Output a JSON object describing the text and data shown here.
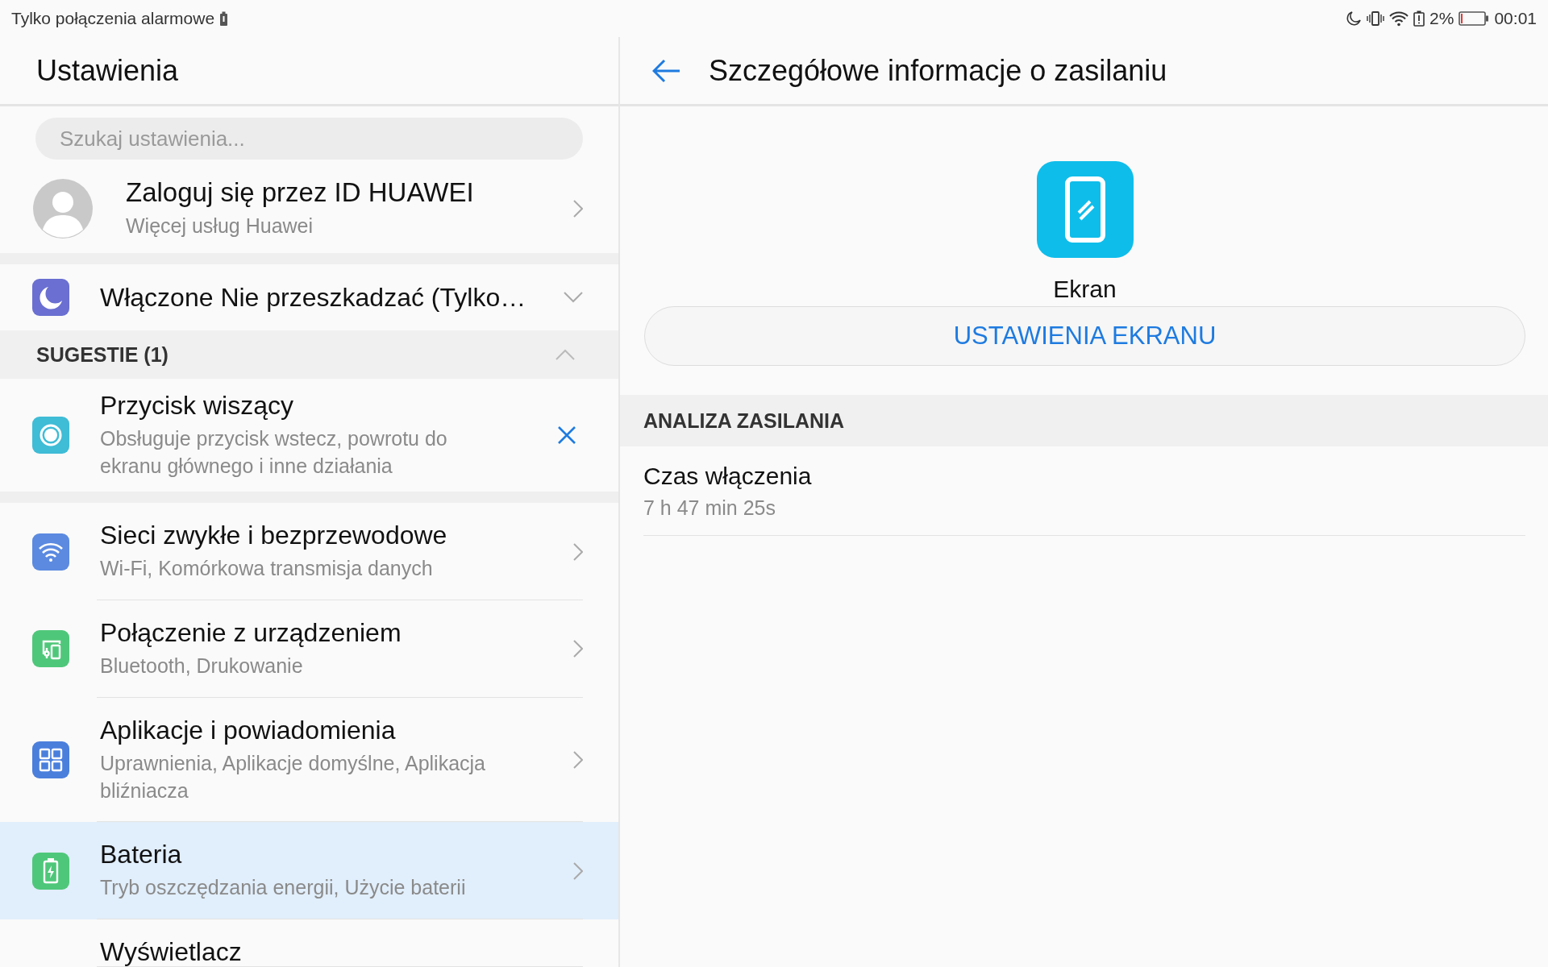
{
  "status_bar": {
    "left_text": "Tylko połączenia alarmowe",
    "battery_percent": "2%",
    "time": "00:01"
  },
  "settings": {
    "title": "Ustawienia",
    "search": {
      "placeholder": "Szukaj ustawienia..."
    },
    "account": {
      "title": "Zaloguj się przez ID HUAWEI",
      "subtitle": "Więcej usług Huawei"
    },
    "dnd": {
      "label": "Włączone Nie przeszkadzać (Tylko…",
      "expanded": false
    },
    "suggestions": {
      "label": "SUGESTIE (1)",
      "expanded": true,
      "items": [
        {
          "title": "Przycisk wiszący",
          "subtitle": "Obsługuje przycisk wstecz, powrotu do ekranu głównego i inne działania"
        }
      ]
    },
    "categories": [
      {
        "kind": "wifi",
        "color": "#5b8ae0",
        "title": "Sieci zwykłe i bezprzewodowe",
        "subtitle": "Wi-Fi, Komórkowa transmisja danych",
        "selected": false
      },
      {
        "kind": "devices",
        "color": "#4fc77a",
        "title": "Połączenie z urządzeniem",
        "subtitle": "Bluetooth, Drukowanie",
        "selected": false
      },
      {
        "kind": "apps",
        "color": "#4a7fdc",
        "title": "Aplikacje i powiadomienia",
        "subtitle": "Uprawnienia, Aplikacje domyślne, Aplikacja bliźniacza",
        "selected": false
      },
      {
        "kind": "battery",
        "color": "#4fc77a",
        "title": "Bateria",
        "subtitle": "Tryb oszczędzania energii, Użycie baterii",
        "selected": true
      },
      {
        "title": "Wyświetlacz",
        "selected": false
      }
    ]
  },
  "detail": {
    "title": "Szczegółowe informacje o zasilaniu",
    "app_name": "Ekran",
    "button": "USTAWIENIA EKRANU",
    "section": "ANALIZA ZASILANIA",
    "items": [
      {
        "title": "Czas włączenia",
        "value": "7 h 47 min 25s"
      }
    ]
  }
}
